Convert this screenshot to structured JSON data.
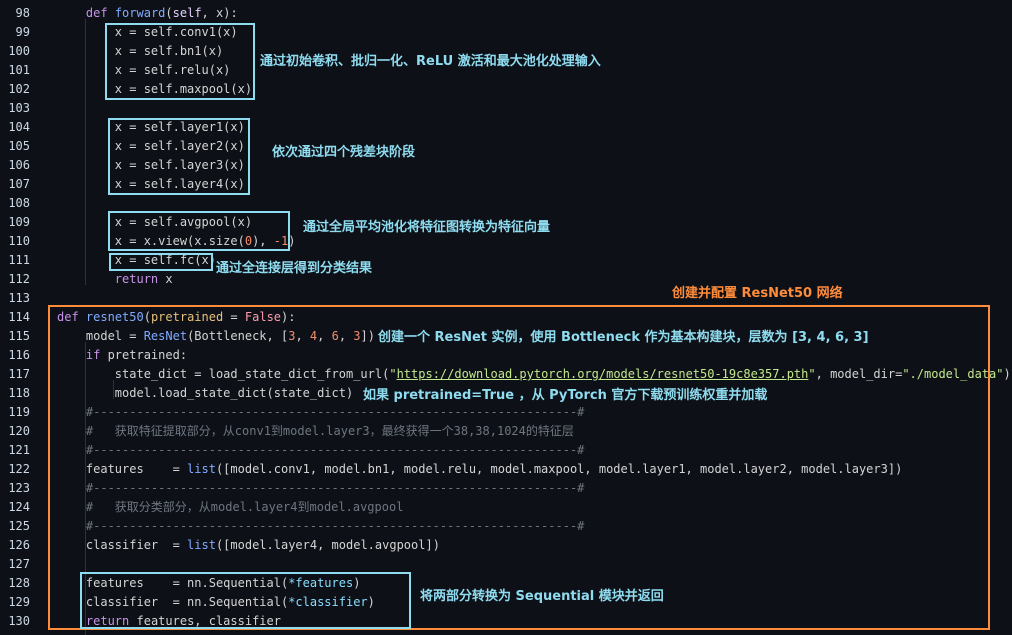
{
  "lines": [
    {
      "n": "98",
      "code": [
        {
          "c": "    "
        },
        {
          "c": "def",
          "t": "kw"
        },
        {
          "c": " "
        },
        {
          "c": "forward",
          "t": "fn"
        },
        {
          "c": "("
        },
        {
          "c": "self",
          "t": "sf"
        },
        {
          "c": ", x):"
        }
      ]
    },
    {
      "n": "99",
      "code": [
        {
          "c": "        x = self.conv1(x)"
        }
      ]
    },
    {
      "n": "100",
      "code": [
        {
          "c": "        x = self.bn1(x)"
        }
      ]
    },
    {
      "n": "101",
      "code": [
        {
          "c": "        x = self.relu(x)"
        }
      ]
    },
    {
      "n": "102",
      "code": [
        {
          "c": "        x = self.maxpool(x)"
        }
      ]
    },
    {
      "n": "103",
      "code": []
    },
    {
      "n": "104",
      "code": [
        {
          "c": "        x = self.layer1(x)"
        }
      ]
    },
    {
      "n": "105",
      "code": [
        {
          "c": "        x = self.layer2(x)"
        }
      ]
    },
    {
      "n": "106",
      "code": [
        {
          "c": "        x = self.layer3(x)"
        }
      ]
    },
    {
      "n": "107",
      "code": [
        {
          "c": "        x = self.layer4(x)"
        }
      ]
    },
    {
      "n": "108",
      "code": []
    },
    {
      "n": "109",
      "code": [
        {
          "c": "        x = self.avgpool(x)"
        }
      ]
    },
    {
      "n": "110",
      "code": [
        {
          "c": "        x = x.view(x.size("
        },
        {
          "c": "0",
          "t": "num"
        },
        {
          "c": "), "
        },
        {
          "c": "-1",
          "t": "num"
        },
        {
          "c": ")"
        }
      ]
    },
    {
      "n": "111",
      "code": [
        {
          "c": "        x = self.fc(x)"
        }
      ]
    },
    {
      "n": "112",
      "code": [
        {
          "c": "        "
        },
        {
          "c": "return",
          "t": "kw"
        },
        {
          "c": " x"
        }
      ]
    },
    {
      "n": "113",
      "code": []
    },
    {
      "n": "114",
      "code": [
        {
          "c": "def",
          "t": "kw"
        },
        {
          "c": " "
        },
        {
          "c": "resnet50",
          "t": "fn"
        },
        {
          "c": "("
        },
        {
          "c": "pretrained",
          "t": "pa"
        },
        {
          "c": " = "
        },
        {
          "c": "False",
          "t": "bl"
        },
        {
          "c": "):"
        }
      ]
    },
    {
      "n": "115",
      "code": [
        {
          "c": "    model = "
        },
        {
          "c": "ResNet",
          "t": "fn"
        },
        {
          "c": "(Bottleneck, ["
        },
        {
          "c": "3",
          "t": "num"
        },
        {
          "c": ", "
        },
        {
          "c": "4",
          "t": "num"
        },
        {
          "c": ", "
        },
        {
          "c": "6",
          "t": "num"
        },
        {
          "c": ", "
        },
        {
          "c": "3",
          "t": "num"
        },
        {
          "c": "])"
        }
      ]
    },
    {
      "n": "116",
      "code": [
        {
          "c": "    "
        },
        {
          "c": "if",
          "t": "kw"
        },
        {
          "c": " pretrained:"
        }
      ]
    },
    {
      "n": "117",
      "code": [
        {
          "c": "        state_dict = load_state_dict_from_url("
        },
        {
          "c": "\"",
          "t": "st"
        },
        {
          "c": "https://download.pytorch.org/models/resnet50-19c8e357.pth",
          "t": "url"
        },
        {
          "c": "\"",
          "t": "st"
        },
        {
          "c": ", model_dir="
        },
        {
          "c": "\"./model_data\"",
          "t": "st"
        },
        {
          "c": ")"
        }
      ]
    },
    {
      "n": "118",
      "code": [
        {
          "c": "        model.load_state_dict(state_dict)"
        }
      ]
    },
    {
      "n": "119",
      "code": [
        {
          "c": "    #-------------------------------------------------------------------#",
          "t": "cm"
        }
      ]
    },
    {
      "n": "120",
      "code": [
        {
          "c": "    #   获取特征提取部分，从conv1到model.layer3，最终获得一个38,38,1024的特征层",
          "t": "cm"
        }
      ]
    },
    {
      "n": "121",
      "code": [
        {
          "c": "    #-------------------------------------------------------------------#",
          "t": "cm"
        }
      ]
    },
    {
      "n": "122",
      "code": [
        {
          "c": "    features    = "
        },
        {
          "c": "list",
          "t": "fn"
        },
        {
          "c": "([model.conv1, model.bn1, model.relu, model.maxpool, model.layer1, model.layer2, model.layer3])"
        }
      ]
    },
    {
      "n": "123",
      "code": [
        {
          "c": "    #-------------------------------------------------------------------#",
          "t": "cm"
        }
      ]
    },
    {
      "n": "124",
      "code": [
        {
          "c": "    #   获取分类部分，从model.layer4到model.avgpool",
          "t": "cm"
        }
      ]
    },
    {
      "n": "125",
      "code": [
        {
          "c": "    #-------------------------------------------------------------------#",
          "t": "cm"
        }
      ]
    },
    {
      "n": "126",
      "code": [
        {
          "c": "    classifier  = "
        },
        {
          "c": "list",
          "t": "fn"
        },
        {
          "c": "([model.layer4, model.avgpool])"
        }
      ]
    },
    {
      "n": "127",
      "code": []
    },
    {
      "n": "128",
      "code": [
        {
          "c": "    features    = nn.Sequential("
        },
        {
          "c": "*features",
          "t": "pn"
        },
        {
          "c": ")"
        }
      ]
    },
    {
      "n": "129",
      "code": [
        {
          "c": "    classifier  = nn.Sequential("
        },
        {
          "c": "*classifier",
          "t": "pn"
        },
        {
          "c": ")"
        }
      ]
    },
    {
      "n": "130",
      "code": [
        {
          "c": "    "
        },
        {
          "c": "return",
          "t": "kw"
        },
        {
          "c": " features, classifier"
        }
      ]
    }
  ],
  "annotations": {
    "stem": "通过初始卷积、批归一化、ReLU 激活和最大池化处理输入",
    "stages": "依次通过四个残差块阶段",
    "pool": "通过全局平均池化将特征图转换为特征向量",
    "fc": "通过全连接层得到分类结果",
    "build_title": "创建并配置 ResNet50 网络",
    "model": "创建一个 ResNet 实例，使用 Bottleneck 作为基本构建块，层数为 [3, 4, 6, 3]",
    "pretrained": "如果 pretrained=True ，从 PyTorch 官方下载预训练权重并加载",
    "sequential": "将两部分转换为 Sequential 模块并返回"
  },
  "colors": {
    "background": "#0d1117",
    "highlight_box": "#8fdcf0",
    "section_box": "#ff8c3a"
  }
}
